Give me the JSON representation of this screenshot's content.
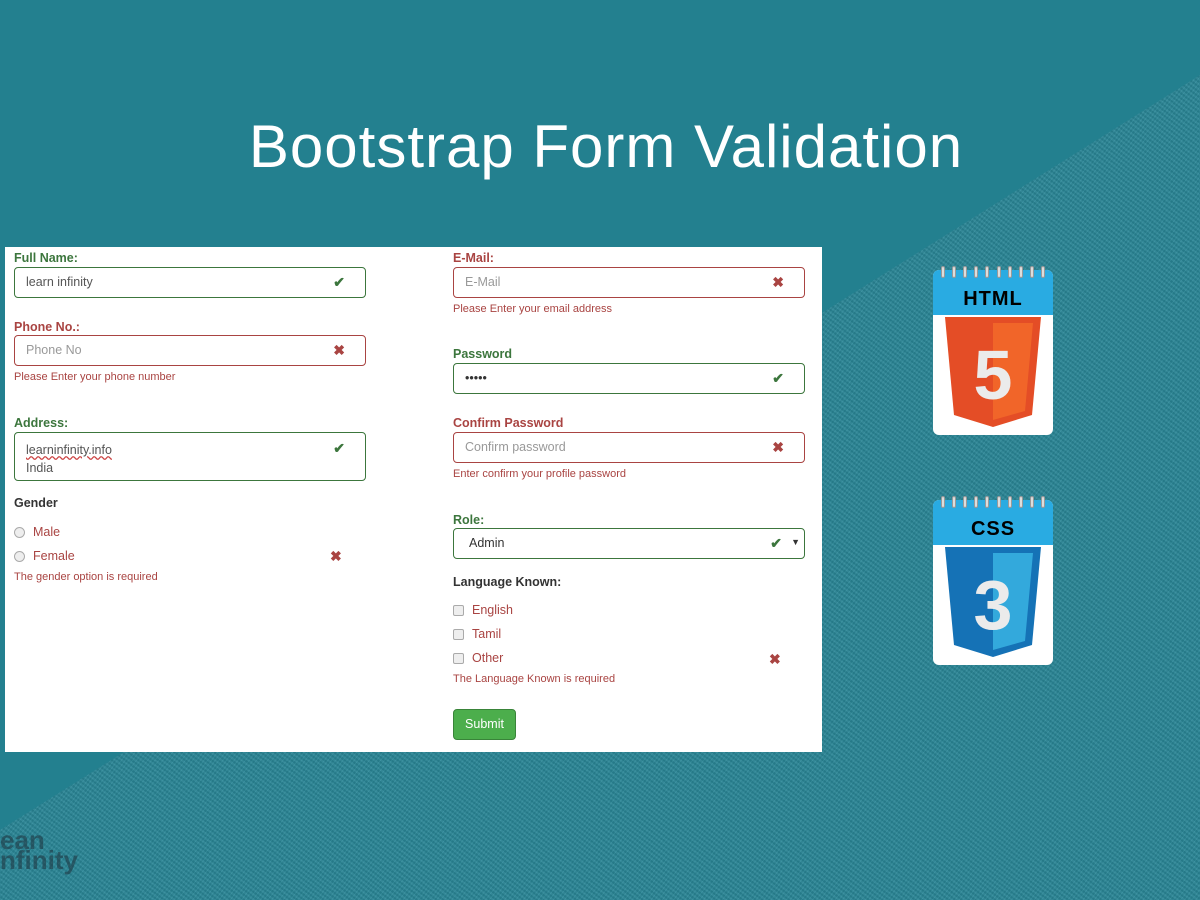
{
  "title": "Bootstrap Form Validation",
  "form": {
    "full_name": {
      "label": "Full Name:",
      "value": "learn infinity",
      "status": "valid"
    },
    "phone": {
      "label": "Phone No.:",
      "placeholder": "Phone No",
      "error": "Please Enter your phone number",
      "status": "invalid"
    },
    "address": {
      "label": "Address:",
      "value_line1": "learninfinity.info",
      "value_line2": "India",
      "status": "valid"
    },
    "gender": {
      "label": "Gender",
      "options": [
        "Male",
        "Female"
      ],
      "error": "The gender option is required",
      "status": "invalid"
    },
    "email": {
      "label": "E-Mail:",
      "placeholder": "E-Mail",
      "error": "Please Enter your email address",
      "status": "invalid"
    },
    "password": {
      "label": "Password",
      "value": "•••••",
      "status": "valid"
    },
    "confirm_password": {
      "label": "Confirm Password",
      "placeholder": "Confirm password",
      "error": "Enter confirm your profile password",
      "status": "invalid"
    },
    "role": {
      "label": "Role:",
      "value": "Admin",
      "status": "valid"
    },
    "language": {
      "label": "Language Known:",
      "options": [
        "English",
        "Tamil",
        "Other"
      ],
      "error": "The Language Known is required",
      "status": "invalid"
    },
    "submit_label": "Submit"
  },
  "icons": {
    "valid": "✔",
    "invalid": "✖"
  },
  "badges": {
    "html": "HTML",
    "html_num": "5",
    "css": "CSS",
    "css_num": "3"
  },
  "logo_text": "learn infinity",
  "colors": {
    "valid": "#3c763d",
    "invalid": "#a94442",
    "submit": "#4cae4c",
    "background": "#23808f"
  }
}
